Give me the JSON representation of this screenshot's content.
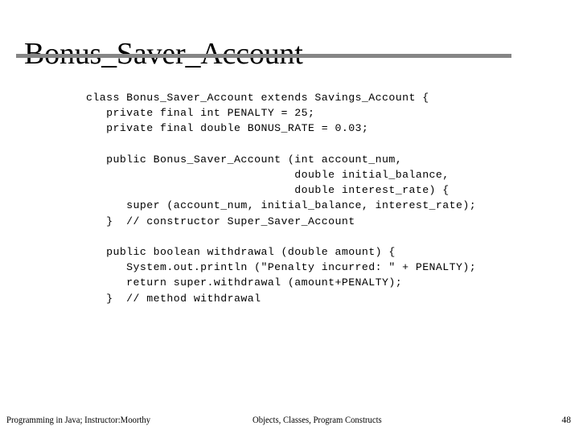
{
  "slide": {
    "title": "Bonus_Saver_Account",
    "page_number": "48",
    "accent_rule_color": "#858585",
    "background_color": "#ffffff",
    "text_color": "#000000"
  },
  "code": {
    "language": "java",
    "lines": [
      "class Bonus_Saver_Account extends Savings_Account {",
      "   private final int PENALTY = 25;",
      "   private final double BONUS_RATE = 0.03;",
      "",
      "   public Bonus_Saver_Account (int account_num,",
      "                               double initial_balance,",
      "                               double interest_rate) {",
      "      super (account_num, initial_balance, interest_rate);",
      "   }  // constructor Super_Saver_Account",
      "",
      "   public boolean withdrawal (double amount) {",
      "      System.out.println (\"Penalty incurred: \" + PENALTY);",
      "      return super.withdrawal (amount+PENALTY);",
      "   }  // method withdrawal"
    ]
  },
  "footer": {
    "left": "Programming in Java; Instructor:Moorthy",
    "center": "Objects, Classes, Program Constructs",
    "right": "48"
  }
}
